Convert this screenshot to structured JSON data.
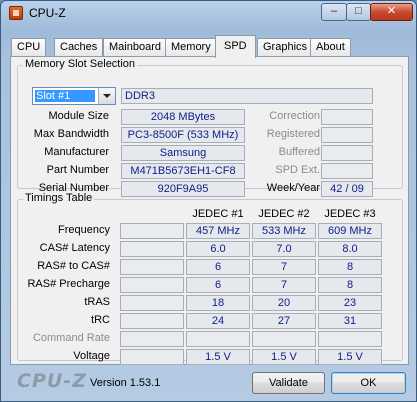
{
  "window": {
    "title": "CPU-Z",
    "controls": {
      "minimize": "–",
      "maximize": "□",
      "close": "✕"
    }
  },
  "tabs": [
    {
      "label": "CPU"
    },
    {
      "label": "Caches"
    },
    {
      "label": "Mainboard"
    },
    {
      "label": "Memory"
    },
    {
      "label": "SPD",
      "active": true
    },
    {
      "label": "Graphics"
    },
    {
      "label": "About"
    }
  ],
  "slot_selection": {
    "legend": "Memory Slot Selection",
    "selected_slot": "Slot #1",
    "memory_type": "DDR3",
    "left_fields": [
      {
        "label": "Module Size",
        "value": "2048 MBytes"
      },
      {
        "label": "Max Bandwidth",
        "value": "PC3-8500F (533 MHz)"
      },
      {
        "label": "Manufacturer",
        "value": "Samsung"
      },
      {
        "label": "Part Number",
        "value": "M471B5673EH1-CF8"
      },
      {
        "label": "Serial Number",
        "value": "920F9A95"
      }
    ],
    "right_fields": [
      {
        "label": "Correction",
        "value": ""
      },
      {
        "label": "Registered",
        "value": ""
      },
      {
        "label": "Buffered",
        "value": ""
      },
      {
        "label": "SPD Ext.",
        "value": ""
      },
      {
        "label": "Week/Year",
        "value": "42 / 09"
      }
    ]
  },
  "timings": {
    "legend": "Timings Table",
    "columns": [
      "JEDEC #1",
      "JEDEC #2",
      "JEDEC #3"
    ],
    "rows": [
      {
        "label": "Frequency",
        "values": [
          "457 MHz",
          "533 MHz",
          "609 MHz"
        ]
      },
      {
        "label": "CAS# Latency",
        "values": [
          "6.0",
          "7.0",
          "8.0"
        ]
      },
      {
        "label": "RAS# to CAS#",
        "values": [
          "6",
          "7",
          "8"
        ]
      },
      {
        "label": "RAS# Precharge",
        "values": [
          "6",
          "7",
          "8"
        ]
      },
      {
        "label": "tRAS",
        "values": [
          "18",
          "20",
          "23"
        ]
      },
      {
        "label": "tRC",
        "values": [
          "24",
          "27",
          "31"
        ]
      },
      {
        "label": "Command Rate",
        "values": [
          "",
          "",
          ""
        ]
      },
      {
        "label": "Voltage",
        "values": [
          "1.5 V",
          "1.5 V",
          "1.5 V"
        ]
      }
    ]
  },
  "footer": {
    "logo": "CPU-Z",
    "version": "Version 1.53.1",
    "validate_label": "Validate",
    "ok_label": "OK"
  }
}
